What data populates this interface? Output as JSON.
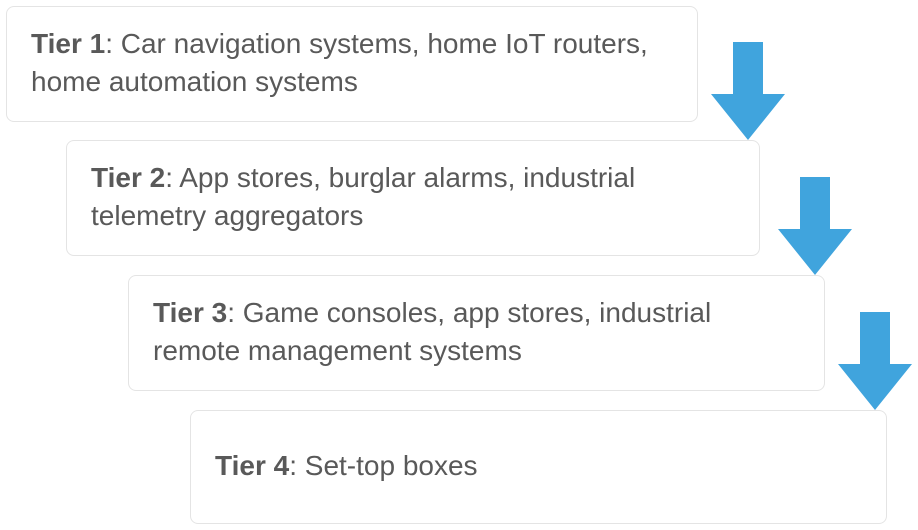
{
  "tiers": [
    {
      "label": "Tier 1",
      "text": ": Car navigation systems, home IoT routers, home automation systems"
    },
    {
      "label": "Tier 2",
      "text": ": App stores, burglar alarms, industrial telemetry aggregators"
    },
    {
      "label": "Tier 3",
      "text": ": Game consoles, app stores, industrial remote management systems"
    },
    {
      "label": "Tier 4",
      "text": ": Set-top boxes"
    }
  ],
  "arrow_icon_name": "arrow-down-icon",
  "colors": {
    "arrow": "#40a4dd",
    "box_border": "#e4e4e4",
    "text": "#595959"
  }
}
